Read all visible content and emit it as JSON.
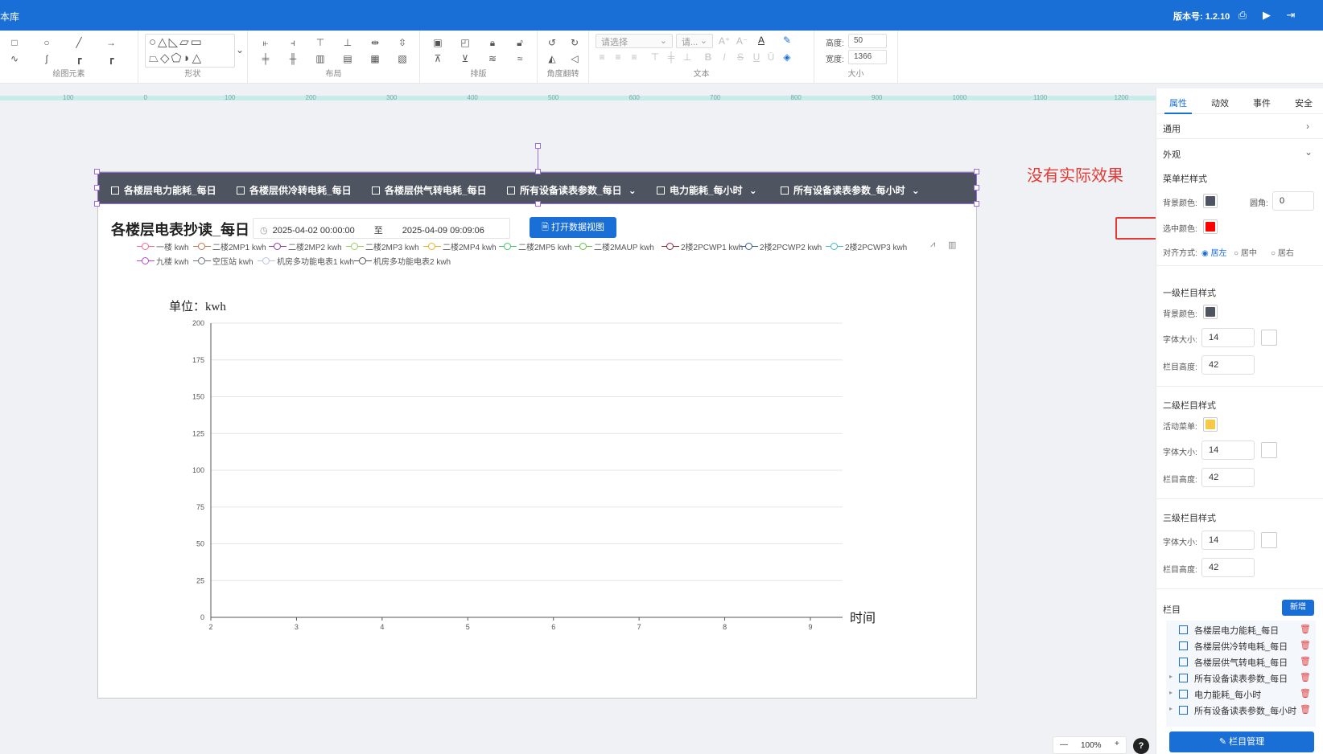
{
  "app": {
    "title": "本库",
    "version": "版本号: 1.2.10"
  },
  "toolbar": {
    "groups": {
      "draw": "绘图元素",
      "shape": "形状",
      "layout": "布局",
      "arrange": "排版",
      "rotate": "角度翻转",
      "text": "文本",
      "size": "大小"
    },
    "text_select_placeholder": "请选择",
    "font_select_placeholder": "请...",
    "height_label": "高度:",
    "height_value": "50",
    "width_label": "宽度:",
    "width_value": "1366"
  },
  "ruler": {
    "ticks": [
      "100",
      "0",
      "100",
      "200",
      "300",
      "400",
      "500",
      "600",
      "700",
      "800",
      "900",
      "1000",
      "1100",
      "1200"
    ]
  },
  "menubar": {
    "items": [
      {
        "label": "各楼层电力能耗_每日",
        "has_arrow": false
      },
      {
        "label": "各楼层供冷转电耗_每日",
        "has_arrow": false
      },
      {
        "label": "各楼层供气转电耗_每日",
        "has_arrow": false
      },
      {
        "label": "所有设备读表参数_每日",
        "has_arrow": true
      },
      {
        "label": "电力能耗_每小时",
        "has_arrow": true
      },
      {
        "label": "所有设备读表参数_每小时",
        "has_arrow": true
      }
    ],
    "colors": {
      "background": "#4f5560",
      "selected": "#ff0000"
    }
  },
  "chart_panel": {
    "title": "各楼层电表抄读_每日",
    "date_start": "2025-04-02 00:00:00",
    "date_sep": "至",
    "date_end": "2025-04-09 09:09:06",
    "open_button": "打开数据视图"
  },
  "chart_data": {
    "type": "line",
    "ylabel": "单位：kwh",
    "xlabel": "时间",
    "ylim": [
      0,
      200
    ],
    "y_ticks": [
      0,
      25,
      50,
      75,
      100,
      125,
      150,
      175,
      200
    ],
    "x": [
      2,
      3,
      4,
      5,
      6,
      7,
      8,
      9
    ],
    "grid": true,
    "legend_placement": "top",
    "series": [
      {
        "name": "一楼 kwh",
        "color": "#f36c8c",
        "values": []
      },
      {
        "name": "二楼2MP1 kwh",
        "color": "#c2774f",
        "values": []
      },
      {
        "name": "二楼2MP2 kwh",
        "color": "#8e3a9e",
        "values": []
      },
      {
        "name": "二楼2MP3 kwh",
        "color": "#9ccc65",
        "values": []
      },
      {
        "name": "二楼2MP4 kwh",
        "color": "#e6b422",
        "values": []
      },
      {
        "name": "二楼2MP5 kwh",
        "color": "#3fc46a",
        "values": []
      },
      {
        "name": "二楼2MAUP kwh",
        "color": "#6cc04a",
        "values": []
      },
      {
        "name": "2楼2PCWP1 kwh",
        "color": "#8a2a3a",
        "values": []
      },
      {
        "name": "2楼2PCWP2 kwh",
        "color": "#3a5e8a",
        "values": []
      },
      {
        "name": "2楼2PCWP3 kwh",
        "color": "#4ab8c4",
        "values": []
      },
      {
        "name": "九楼 kwh",
        "color": "#b44ad4",
        "values": []
      },
      {
        "name": "空压站 kwh",
        "color": "#6a7080",
        "values": []
      },
      {
        "name": "机房多功能电表1 kwh",
        "color": "#b9c4e0",
        "values": []
      },
      {
        "name": "机房多功能电表2 kwh",
        "color": "#555555",
        "values": []
      }
    ]
  },
  "annotation": {
    "text": "没有实际效果",
    "color": "#e53935"
  },
  "right_panel": {
    "tabs": [
      "属性",
      "动效",
      "事件",
      "安全"
    ],
    "general": "通用",
    "appearance": "外观",
    "menu_style": {
      "title": "菜单栏样式",
      "bg_label": "背景颜色:",
      "bg_color": "#4f5560",
      "radius_label": "圆角:",
      "radius_value": "0",
      "selected_label": "选中颜色:",
      "selected_color": "#ff0000",
      "align_label": "对齐方式:",
      "align_options": [
        "居左",
        "居中",
        "居右"
      ]
    },
    "level1": {
      "title": "一级栏目样式",
      "bg_label": "背景颜色:",
      "bg_color": "#4f5560",
      "font_label": "字体大小:",
      "font_value": "14",
      "height_label": "栏目高度:",
      "height_value": "42"
    },
    "level2": {
      "title": "二级栏目样式",
      "active_label": "活动菜单:",
      "active_color": "#f7c948",
      "font_label": "字体大小:",
      "font_value": "14",
      "height_label": "栏目高度:",
      "height_value": "42"
    },
    "level3": {
      "title": "三级栏目样式",
      "font_label": "字体大小:",
      "font_value": "14",
      "height_label": "栏目高度:",
      "height_value": "42"
    },
    "columns": {
      "title": "栏目",
      "add_button": "新增",
      "items": [
        "各楼层电力能耗_每日",
        "各楼层供冷转电耗_每日",
        "各楼层供气转电耗_每日",
        "所有设备读表参数_每日",
        "电力能耗_每小时",
        "所有设备读表参数_每小时"
      ],
      "manage_button": "栏目管理"
    }
  },
  "zoom": {
    "value": "100%",
    "minus": "—",
    "plus": "+",
    "help": "?"
  }
}
